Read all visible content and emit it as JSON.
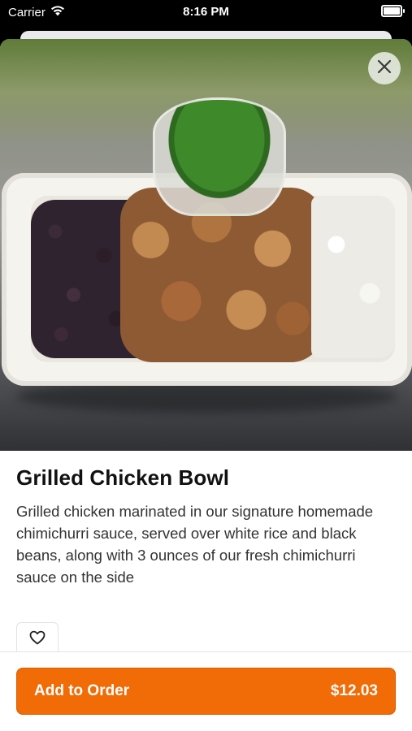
{
  "status_bar": {
    "carrier": "Carrier",
    "time": "8:16 PM"
  },
  "item": {
    "name": "Grilled Chicken Bowl",
    "description": "Grilled chicken marinated in our signature homemade chimichurri sauce, served over white rice and black beans, along with 3 ounces of our fresh chimichurri sauce on the side"
  },
  "actions": {
    "add_to_order_label": "Add to Order",
    "price": "$12.03"
  },
  "icons": {
    "close": "close-icon",
    "favorite": "heart-icon",
    "wifi": "wifi-icon",
    "battery": "battery-icon"
  },
  "colors": {
    "accent": "#f16b06"
  }
}
